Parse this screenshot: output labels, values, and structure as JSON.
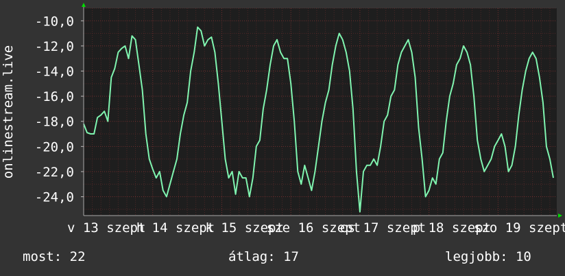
{
  "chart_data": {
    "type": "line",
    "ylabel": "onlinestream.live",
    "ylim": [
      -25.5,
      -9.0
    ],
    "yticks": [
      -10.0,
      -12.0,
      -14.0,
      -16.0,
      -18.0,
      -20.0,
      -22.0,
      -24.0
    ],
    "ytick_labels": [
      "-10,0",
      "-12,0",
      "-14,0",
      "-16,0",
      "-18,0",
      "-20,0",
      "-22,0",
      "-24,0"
    ],
    "xlim": [
      0,
      6.85
    ],
    "x_tick_labels": [
      {
        "x": 0.33,
        "label": "v 13 szept"
      },
      {
        "x": 1.33,
        "label": "h 14 szept"
      },
      {
        "x": 2.33,
        "label": "k 15 szept"
      },
      {
        "x": 3.33,
        "label": "sze 16 szept"
      },
      {
        "x": 4.33,
        "label": "cs 17 szept"
      },
      {
        "x": 5.33,
        "label": "p 18 szept"
      },
      {
        "x": 6.33,
        "label": "szo 19 szept"
      }
    ],
    "grid": true,
    "colors": {
      "background": "#333333",
      "plot": "#1e1e1e",
      "line": "#80f5b0",
      "grid": "#7a3030",
      "arrow": "#00dd00"
    },
    "series": [
      {
        "x": [
          0.0,
          0.05,
          0.1,
          0.15,
          0.2,
          0.25,
          0.3,
          0.35,
          0.4,
          0.45,
          0.5,
          0.55,
          0.6,
          0.65,
          0.7,
          0.75,
          0.8,
          0.85,
          0.9,
          0.95,
          1.0,
          1.05,
          1.1,
          1.15,
          1.2,
          1.25,
          1.3,
          1.35,
          1.4,
          1.45,
          1.5,
          1.55,
          1.6,
          1.65,
          1.7,
          1.75,
          1.8,
          1.85,
          1.9,
          1.95,
          2.0,
          2.05,
          2.1,
          2.15,
          2.2,
          2.25,
          2.3,
          2.35,
          2.4,
          2.45,
          2.5,
          2.55,
          2.6,
          2.65,
          2.7,
          2.75,
          2.8,
          2.85,
          2.9,
          2.95,
          3.0,
          3.05,
          3.1,
          3.15,
          3.2,
          3.25,
          3.3,
          3.35,
          3.4,
          3.45,
          3.5,
          3.55,
          3.6,
          3.65,
          3.7,
          3.75,
          3.8,
          3.85,
          3.9,
          3.95,
          4.0,
          4.05,
          4.1,
          4.15,
          4.2,
          4.25,
          4.3,
          4.35,
          4.4,
          4.45,
          4.5,
          4.55,
          4.6,
          4.65,
          4.7,
          4.75,
          4.8,
          4.85,
          4.9,
          4.95,
          5.0,
          5.05,
          5.1,
          5.15,
          5.2,
          5.25,
          5.3,
          5.35,
          5.4,
          5.45,
          5.5,
          5.55,
          5.6,
          5.65,
          5.7,
          5.75,
          5.8,
          5.85,
          5.9,
          5.95,
          6.0,
          6.05,
          6.1,
          6.15,
          6.2,
          6.25,
          6.3,
          6.35,
          6.4,
          6.45,
          6.5,
          6.55,
          6.6,
          6.65,
          6.7,
          6.75,
          6.8
        ],
        "values": [
          -18.2,
          -18.9,
          -19.0,
          -19.0,
          -17.7,
          -17.5,
          -17.2,
          -18.0,
          -14.5,
          -13.8,
          -12.5,
          -12.2,
          -12.0,
          -13.0,
          -11.2,
          -11.5,
          -13.5,
          -15.5,
          -19.0,
          -21.0,
          -21.8,
          -22.5,
          -22.0,
          -23.5,
          -24.0,
          -23.0,
          -22.0,
          -21.0,
          -19.0,
          -17.5,
          -16.5,
          -14.0,
          -12.5,
          -10.5,
          -10.8,
          -12.0,
          -11.5,
          -11.3,
          -12.5,
          -15.0,
          -18.0,
          -21.0,
          -22.5,
          -22.0,
          -23.8,
          -22.0,
          -22.5,
          -22.5,
          -24.0,
          -22.5,
          -20.0,
          -19.5,
          -17.0,
          -15.5,
          -13.5,
          -12.0,
          -11.5,
          -12.5,
          -13.0,
          -13.0,
          -15.0,
          -18.0,
          -22.0,
          -23.0,
          -21.5,
          -22.5,
          -23.5,
          -22.0,
          -20.0,
          -18.0,
          -16.5,
          -15.5,
          -13.5,
          -12.0,
          -11.0,
          -11.5,
          -12.5,
          -14.0,
          -17.0,
          -22.0,
          -25.2,
          -22.0,
          -21.5,
          -21.5,
          -21.0,
          -21.5,
          -20.0,
          -18.0,
          -17.5,
          -16.0,
          -15.5,
          -13.5,
          -12.5,
          -12.0,
          -11.5,
          -12.5,
          -14.5,
          -18.5,
          -21.0,
          -24.0,
          -23.5,
          -22.5,
          -23.0,
          -21.0,
          -20.5,
          -18.0,
          -16.0,
          -15.0,
          -13.5,
          -13.0,
          -12.0,
          -12.5,
          -13.5,
          -16.0,
          -19.5,
          -21.0,
          -22.0,
          -21.5,
          -21.0,
          -20.0,
          -19.5,
          -19.0,
          -20.0,
          -22.0,
          -21.5,
          -20.0,
          -17.5,
          -15.5,
          -14.0,
          -13.0,
          -12.5,
          -13.0,
          -14.5,
          -16.5,
          -20.0,
          -21.0,
          -22.5
        ]
      }
    ]
  },
  "legend": {
    "current": "most: 22",
    "average": "átlag: 17",
    "max": "legjobb: 10"
  }
}
